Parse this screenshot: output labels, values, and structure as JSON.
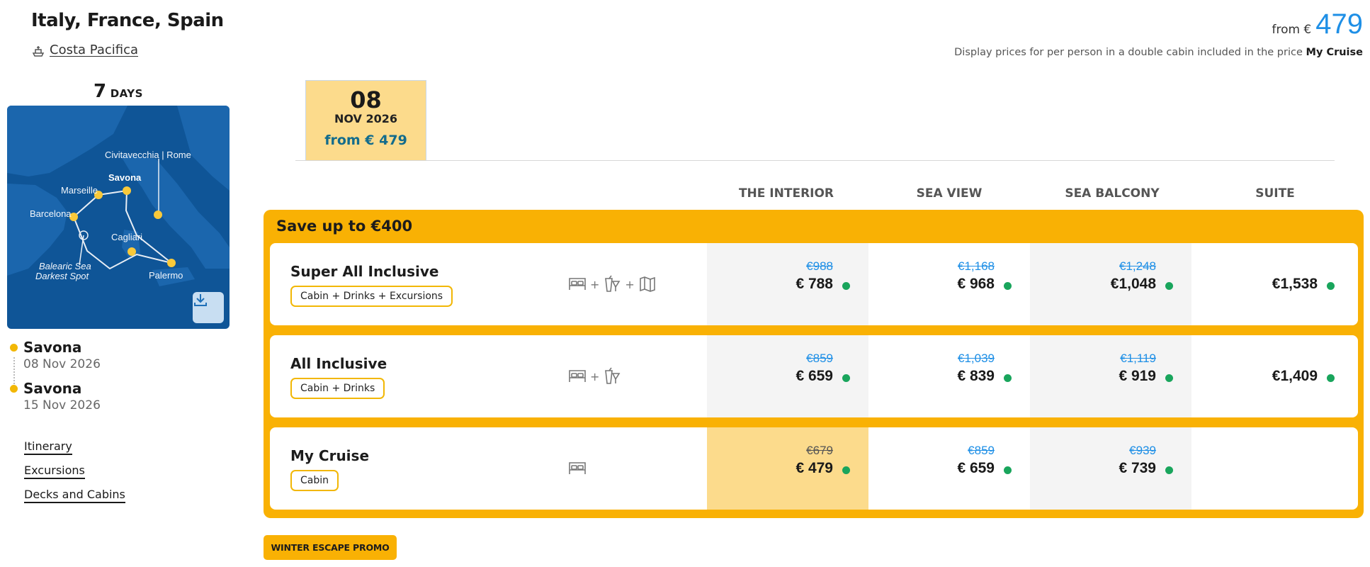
{
  "header": {
    "title": "Italy, France, Spain",
    "ship_name": " Costa Pacifica",
    "from_prefix": "from €",
    "from_price": "479",
    "display_note_text": "Display prices for per person in a double cabin included in the price ",
    "display_note_bold": "My Cruise"
  },
  "trip": {
    "days_number": "7",
    "days_label": "DAYS"
  },
  "map": {
    "ports": [
      "Civitavecchia | Rome",
      "Savona",
      "Marseille",
      "Barcelona",
      "Cagliari",
      "Balearic Sea",
      "Darkest Spot",
      "Palermo"
    ],
    "download_icon": "download-icon"
  },
  "route": [
    {
      "port": "Savona",
      "date": "08 Nov 2026"
    },
    {
      "port": "Savona",
      "date": "15 Nov 2026"
    }
  ],
  "links": [
    "Itinerary",
    "Excursions",
    "Decks and Cabins"
  ],
  "date_tab": {
    "day": "08",
    "month": "NOV 2026",
    "from": "from € 479"
  },
  "columns": [
    "THE INTERIOR",
    "SEA VIEW",
    "SEA BALCONY",
    "SUITE"
  ],
  "save_label": "Save up to €400",
  "packages": [
    {
      "name": "Super All Inclusive",
      "badge": "Cabin + Drinks + Excursions",
      "icons": [
        "bed-icon",
        "drinks-icon",
        "map-icon"
      ],
      "prices": [
        {
          "old": "€988",
          "new": "€ 788"
        },
        {
          "old": "€1,168",
          "new": "€ 968"
        },
        {
          "old": "€1,248",
          "new": "€1,048"
        },
        {
          "old": "",
          "new": "€1,538"
        }
      ]
    },
    {
      "name": "All Inclusive",
      "badge": "Cabin + Drinks",
      "icons": [
        "bed-icon",
        "drinks-icon"
      ],
      "prices": [
        {
          "old": "€859",
          "new": "€ 659"
        },
        {
          "old": "€1,039",
          "new": "€ 839"
        },
        {
          "old": "€1,119",
          "new": "€ 919"
        },
        {
          "old": "",
          "new": "€1,409"
        }
      ]
    },
    {
      "name": "My Cruise",
      "badge": "Cabin",
      "icons": [
        "bed-icon"
      ],
      "prices": [
        {
          "old": "€679",
          "new": "€ 479"
        },
        {
          "old": "€859",
          "new": "€ 659"
        },
        {
          "old": "€939",
          "new": "€ 739"
        }
      ]
    }
  ],
  "promo_label": "WINTER ESCAPE PROMO",
  "colors": {
    "accent": "#f9b104",
    "highlight": "#fcdb8c",
    "blue": "#1e8fe6",
    "available": "#19a55c",
    "map_sea": "#0f5597"
  }
}
